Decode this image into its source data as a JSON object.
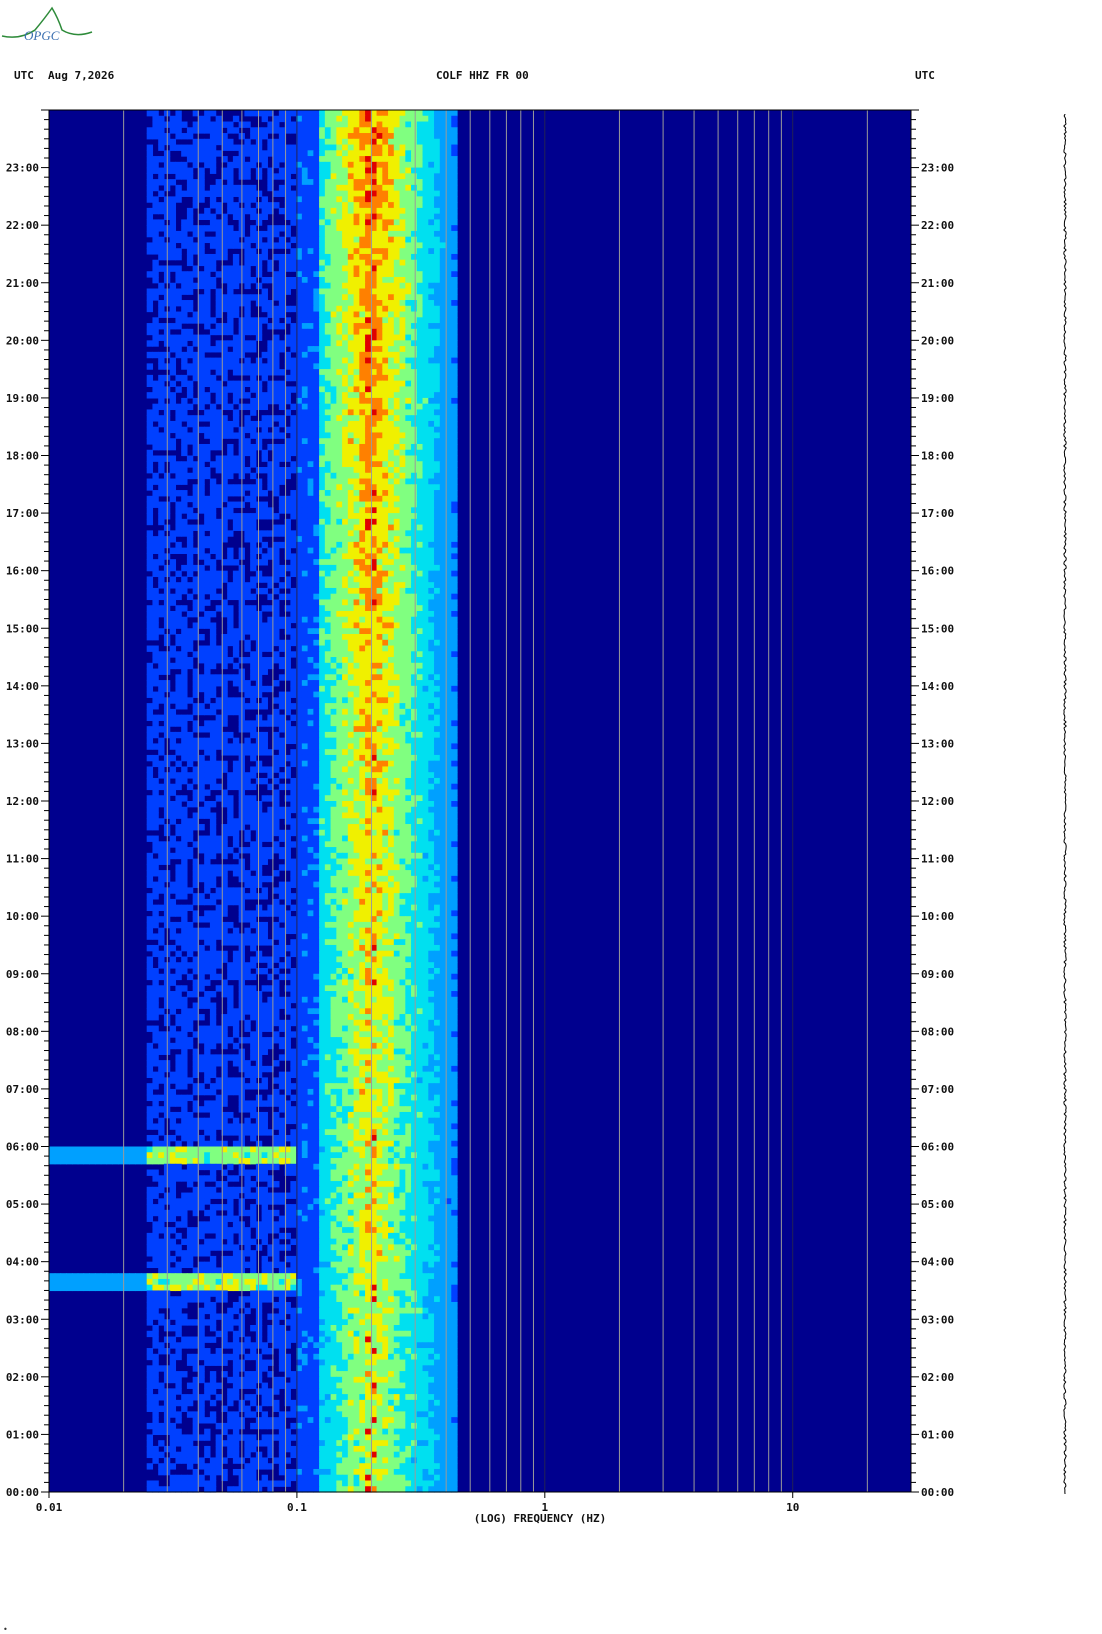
{
  "header": {
    "left_tz": "UTC",
    "date": "Aug 7,2026",
    "station": "COLF HHZ FR 00",
    "right_tz": "UTC"
  },
  "logo": {
    "text": "OPGC",
    "color": "#2e8b3a"
  },
  "chart_data": {
    "type": "heatmap",
    "title": "COLF HHZ FR 00",
    "xlabel": "(LOG) FREQUENCY (HZ)",
    "ylabel": "",
    "x_scale": "log",
    "xlim": [
      0.01,
      30
    ],
    "x_ticks": [
      {
        "value": 0.01,
        "label": "0.01"
      },
      {
        "value": 0.1,
        "label": "0.1"
      },
      {
        "value": 1,
        "label": "1"
      },
      {
        "value": 10,
        "label": "10"
      }
    ],
    "ylim_hours": [
      0,
      24
    ],
    "y_ticks": [
      "00:00",
      "01:00",
      "02:00",
      "03:00",
      "04:00",
      "05:00",
      "06:00",
      "07:00",
      "08:00",
      "09:00",
      "10:00",
      "11:00",
      "12:00",
      "13:00",
      "14:00",
      "15:00",
      "16:00",
      "17:00",
      "18:00",
      "19:00",
      "20:00",
      "21:00",
      "22:00",
      "23:00"
    ],
    "grid": true,
    "colormap": [
      "#00008e",
      "#0000d8",
      "#0040ff",
      "#00a0ff",
      "#00e0f0",
      "#80ff80",
      "#f0f000",
      "#ff8000",
      "#e00000"
    ],
    "features": [
      {
        "name": "microseism band",
        "freq_range_hz": [
          0.12,
          0.45
        ],
        "peak_hz": 0.2,
        "time_range_h": [
          0,
          24
        ]
      },
      {
        "name": "long-period event",
        "freq_range_hz": [
          0.01,
          0.1
        ],
        "time_h": 5.85
      },
      {
        "name": "long-period event",
        "freq_range_hz": [
          0.01,
          0.1
        ],
        "time_h": 3.65
      }
    ]
  }
}
